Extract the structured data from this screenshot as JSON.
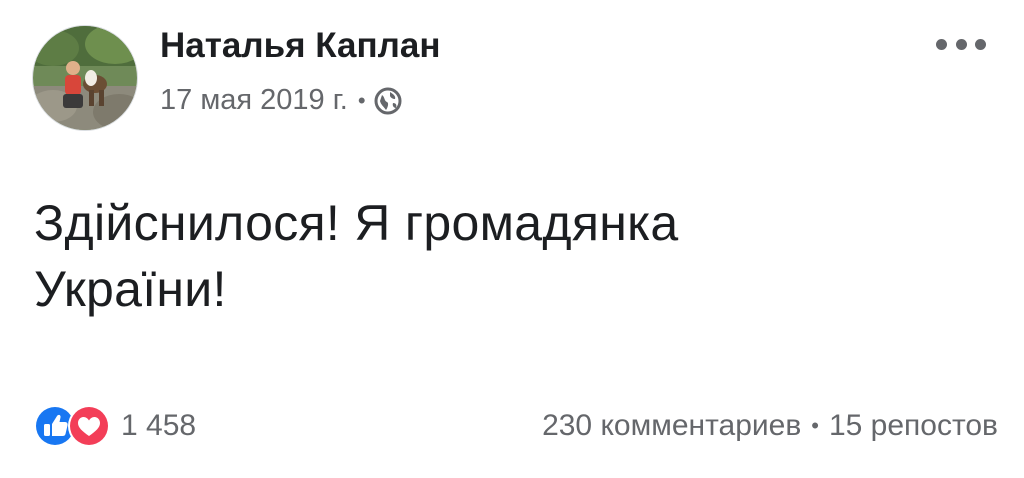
{
  "post": {
    "author": "Наталья Каплан",
    "date": "17 мая 2019 г.",
    "separator": "•",
    "privacy_icon": "globe-icon",
    "message_lines": [
      "Здійснилося! Я громадянка",
      "України!"
    ],
    "reactions": {
      "icons": [
        "like-icon",
        "love-icon"
      ],
      "count": "1 458"
    },
    "comments": "230 комментариев",
    "shares": "15 репостов",
    "more_icon": "more-options-icon"
  },
  "colors": {
    "text_primary": "#1c1e21",
    "text_secondary": "#65676b",
    "like_blue": "#1877f2",
    "love_red": "#f33e58"
  }
}
